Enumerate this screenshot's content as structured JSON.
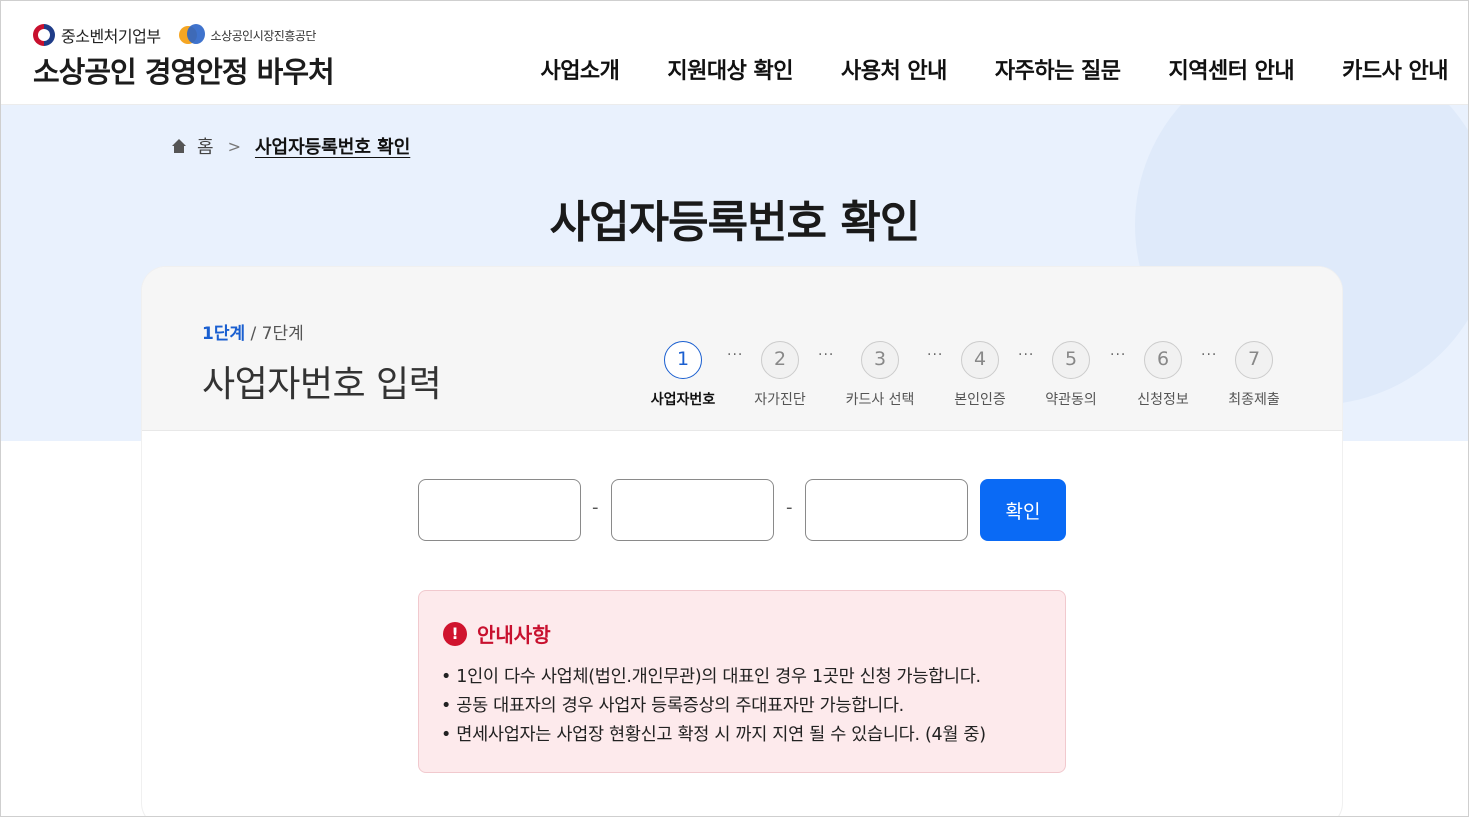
{
  "header": {
    "ministry": "중소벤처기업부",
    "agency": "소상공인시장진흥공단",
    "brand": "소상공인 경영안정 바우처",
    "nav": [
      "사업소개",
      "지원대상 확인",
      "사용처 안내",
      "자주하는 질문",
      "지역센터 안내",
      "카드사 안내"
    ]
  },
  "breadcrumb": {
    "home": "홈",
    "separator": ">",
    "current": "사업자등록번호 확인"
  },
  "page_title": "사업자등록번호 확인",
  "card": {
    "step_current": "1단계",
    "step_separator": " / ",
    "step_total": "7단계",
    "step_title": "사업자번호 입력",
    "steps": [
      {
        "num": "1",
        "label": "사업자번호"
      },
      {
        "num": "2",
        "label": "자가진단"
      },
      {
        "num": "3",
        "label": "카드사 선택"
      },
      {
        "num": "4",
        "label": "본인인증"
      },
      {
        "num": "5",
        "label": "약관동의"
      },
      {
        "num": "6",
        "label": "신청정보"
      },
      {
        "num": "7",
        "label": "최종제출"
      }
    ],
    "dots": "···",
    "active_step": 1
  },
  "form": {
    "input1_value": "",
    "input2_value": "",
    "input3_value": "",
    "dash": "-",
    "confirm_label": "확인"
  },
  "notice": {
    "icon": "!",
    "title": "안내사항",
    "items": [
      "1인이 다수 사업체(법인.개인무관)의 대표인 경우 1곳만 신청 가능합니다.",
      "공동 대표자의 경우 사업자 등록증상의 주대표자만 가능합니다.",
      "면세사업자는 사업장 현황신고 확정 시 까지 지연 될 수 있습니다. (4월 중)"
    ]
  },
  "colors": {
    "accent": "#0a6af5",
    "active_step": "#1a5fd0",
    "notice_bg": "#fdeaec",
    "notice_title": "#c8102e",
    "hero_bg": "#e9f1fd"
  }
}
